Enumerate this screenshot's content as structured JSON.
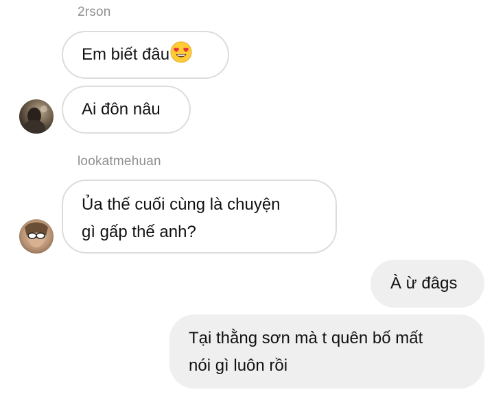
{
  "conversation": {
    "messages": [
      {
        "sender": "2rson",
        "text": "Em biết đâu",
        "emoji": "heart-eyes-emoji"
      },
      {
        "text": "Ai đôn nâu"
      },
      {
        "sender": "lookatmehuan",
        "lines": [
          "Ủa thế cuối cùng là chuyện",
          "gì gấp thế anh?"
        ]
      },
      {
        "text": "À ừ đâgs"
      },
      {
        "lines": [
          "Tại thằng sơn mà t quên bố mất",
          "nói gì luôn rồi"
        ]
      }
    ]
  },
  "colors": {
    "incoming_border": "#dcdcdc",
    "outgoing_bg": "#efefef",
    "sender_name": "#8e8e8e",
    "text": "#111111"
  }
}
